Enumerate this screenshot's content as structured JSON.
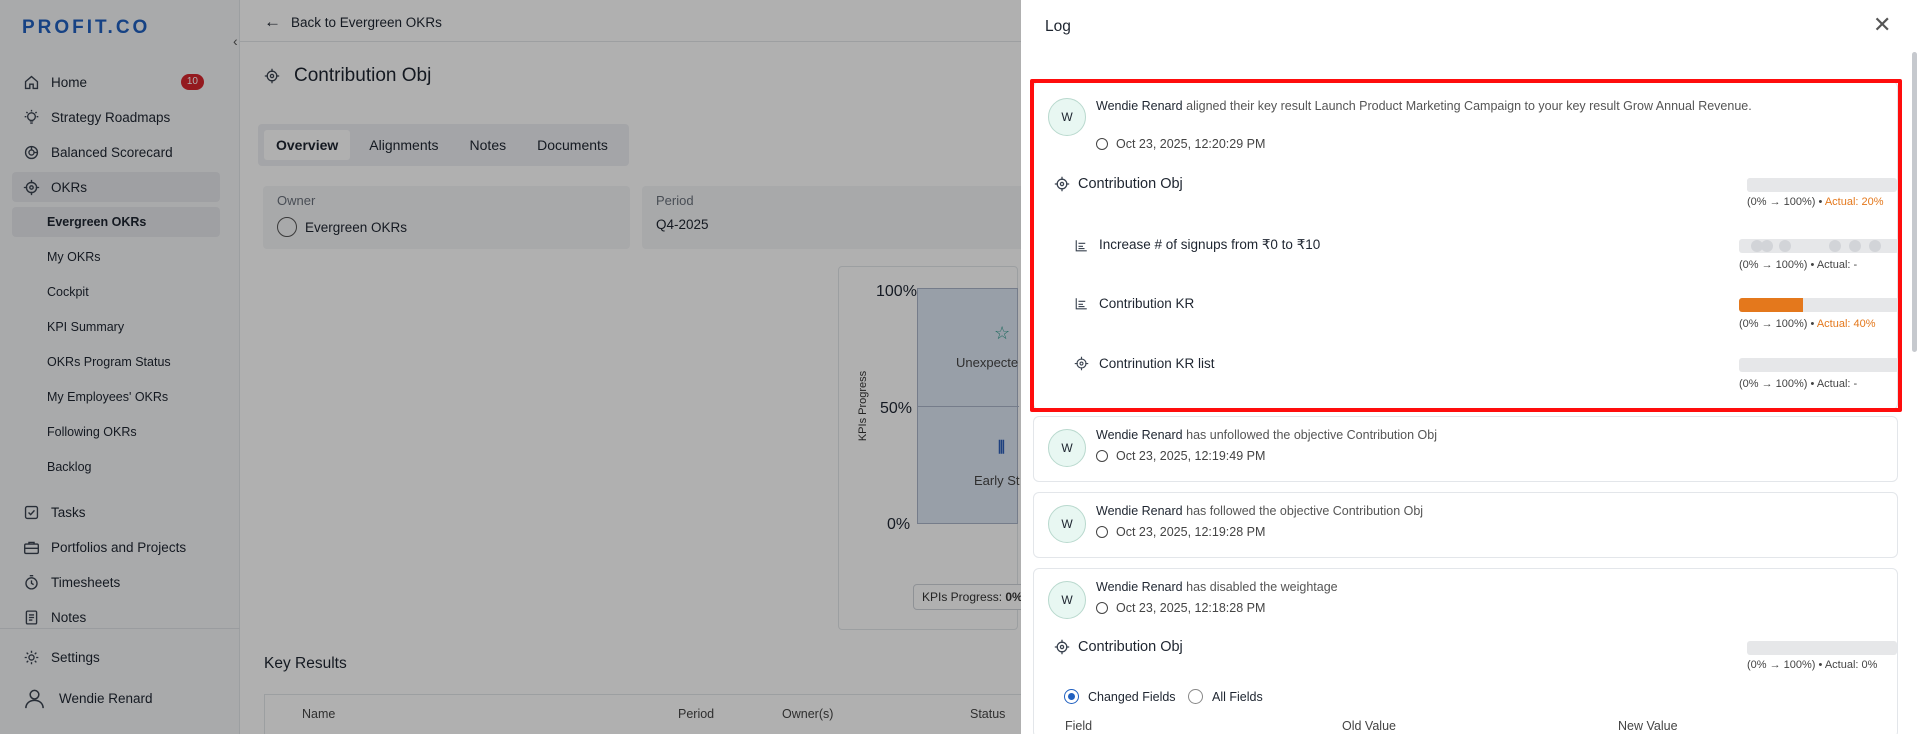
{
  "brand": {
    "logo_text": "PROFIT.CO",
    "accent": "#2060c0"
  },
  "sidebar": {
    "items": [
      {
        "label": "Home",
        "icon": "home-icon",
        "badge": "10"
      },
      {
        "label": "Strategy Roadmaps",
        "icon": "bulb-icon"
      },
      {
        "label": "Balanced Scorecard",
        "icon": "scorecard-icon"
      },
      {
        "label": "OKRs",
        "icon": "target-icon"
      }
    ],
    "okr_subitems": [
      "Evergreen OKRs",
      "My OKRs",
      "Cockpit",
      "KPI Summary",
      "OKRs Program Status",
      "My Employees' OKRs",
      "Following OKRs",
      "Backlog"
    ],
    "items2": [
      {
        "label": "Tasks",
        "icon": "checkbox-icon"
      },
      {
        "label": "Portfolios and Projects",
        "icon": "briefcase-icon"
      },
      {
        "label": "Timesheets",
        "icon": "stopwatch-icon"
      },
      {
        "label": "Notes",
        "icon": "note-icon"
      }
    ],
    "settings": "Settings",
    "user": "Wendie Renard"
  },
  "main": {
    "back_label": "Back to Evergreen OKRs",
    "title": "Contribution Obj",
    "tabs": [
      "Overview",
      "Alignments",
      "Notes",
      "Documents"
    ],
    "owner_label": "Owner",
    "owner_value": "Evergreen OKRs",
    "period_label": "Period",
    "period_value": "Q4-2025",
    "chart": {
      "y_ticks": [
        "100%",
        "50%",
        "0%"
      ],
      "y_label": "KPIs Progress",
      "top_label": "Unexpecte",
      "bottom_label": "Early St",
      "kpi_progress_label": "KPIs Progress: ",
      "kpi_progress_value": "0%"
    },
    "key_results_title": "Key Results",
    "table_headers": [
      "Name",
      "Period",
      "Owner(s)",
      "Status"
    ]
  },
  "log": {
    "title": "Log",
    "entries": [
      {
        "avatar": "W",
        "user": "Wendie Renard",
        "action": "aligned their key result Launch Product Marketing Campaign to your key result Grow Annual Revenue.",
        "time": "Oct 23, 2025, 12:20:29 PM",
        "objective": {
          "name": "Contribution Obj",
          "range": "(0% → 100%) •",
          "actual": "Actual: 20%",
          "progress": 0.2
        },
        "krs": [
          {
            "name": "Increase # of signups from ₹0 to ₹10",
            "range": "(0% → 100%) •",
            "actual": "Actual: -",
            "progress": 0
          },
          {
            "name": "Contribution KR",
            "range": "(0% → 100%) •",
            "actual": "Actual: 40%",
            "progress": 0.4
          },
          {
            "name": "Contrinution KR list",
            "range": "(0% → 100%) •",
            "actual": "Actual: -",
            "progress": 0
          }
        ]
      },
      {
        "avatar": "W",
        "user": "Wendie Renard",
        "action": "has unfollowed the objective Contribution Obj",
        "time": "Oct 23, 2025, 12:19:49 PM"
      },
      {
        "avatar": "W",
        "user": "Wendie Renard",
        "action": "has followed the objective Contribution Obj",
        "time": "Oct 23, 2025, 12:19:28 PM"
      },
      {
        "avatar": "W",
        "user": "Wendie Renard",
        "action": "has disabled the weightage",
        "time": "Oct 23, 2025, 12:18:28 PM",
        "objective": {
          "name": "Contribution Obj",
          "range": "(0% → 100%) • Actual: 0%",
          "progress": 0
        },
        "radio_changed": "Changed Fields",
        "radio_all": "All Fields",
        "field_headers": [
          "Field",
          "Old Value",
          "New Value"
        ]
      }
    ]
  }
}
